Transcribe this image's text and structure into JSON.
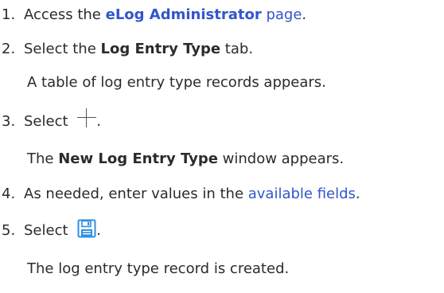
{
  "steps": [
    {
      "num": "1.",
      "prefix": "Access the ",
      "link_bold": "eLog Administrator",
      "link_suffix": " page",
      "suffix": "."
    },
    {
      "num": "2.",
      "prefix": "Select the ",
      "bold": "Log Entry Type",
      "suffix": " tab.",
      "result": "A table of log entry type records appears."
    },
    {
      "num": "3.",
      "prefix": "Select ",
      "icon": "plus-icon",
      "suffix": ".",
      "result_prefix": "The ",
      "result_bold": "New Log Entry Type",
      "result_suffix": " window appears."
    },
    {
      "num": "4.",
      "prefix": "As needed, enter values in the ",
      "link": "available fields",
      "suffix": "."
    },
    {
      "num": "5.",
      "prefix": "Select ",
      "icon": "save-icon",
      "suffix": ".",
      "result": "The log entry type record is created."
    }
  ],
  "colors": {
    "text": "#2b2b2b",
    "link": "#3355cc",
    "icon_blue": "#2f8fe0"
  }
}
